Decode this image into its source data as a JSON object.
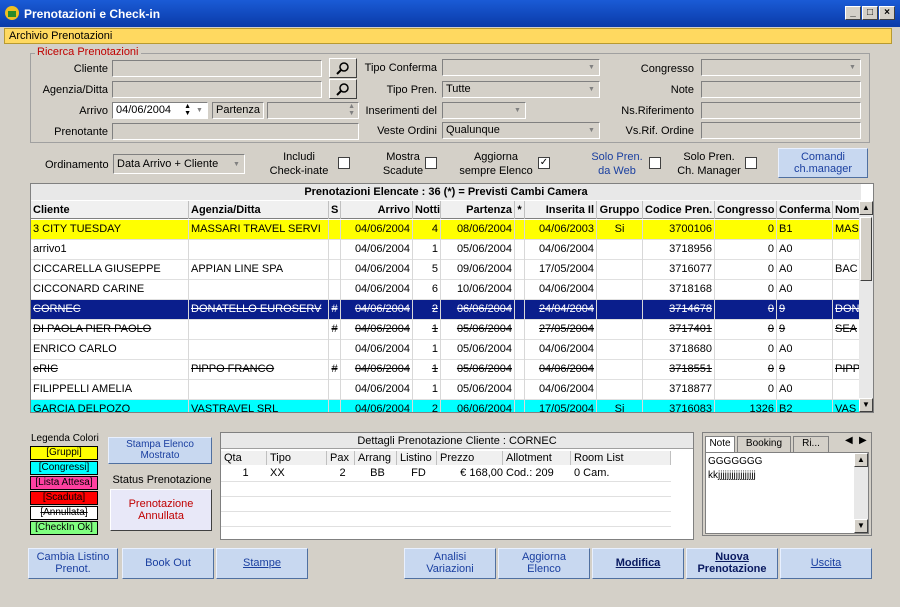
{
  "window": {
    "title": "Prenotazioni e Check-in",
    "min": "_",
    "max": "□",
    "close": "×"
  },
  "archive_bar": "Archivio Prenotazioni",
  "search": {
    "group_title": "Ricerca Prenotazioni",
    "cliente_label": "Cliente",
    "cliente_value": "",
    "agenzia_label": "Agenzia/Ditta",
    "agenzia_value": "",
    "arrivo_label": "Arrivo",
    "arrivo_value": "04/06/2004",
    "partenza_label": "Partenza",
    "partenza_value": "",
    "prenotante_label": "Prenotante",
    "prenotante_value": "",
    "tipo_conferma_label": "Tipo Conferma",
    "tipo_conferma_value": "",
    "tipo_pren_label": "Tipo Pren.",
    "tipo_pren_value": "Tutte",
    "inserimenti_label": "Inserimenti del",
    "inserimenti_value": "",
    "veste_label": "Veste Ordini",
    "veste_value": "Qualunque",
    "congresso_label": "Congresso",
    "congresso_value": "",
    "note_label": "Note",
    "note_value": "",
    "nsrif_label": "Ns.Riferimento",
    "nsrif_value": "",
    "vsrif_label": "Vs.Rif. Ordine",
    "vsrif_value": ""
  },
  "options": {
    "ordinamento_label": "Ordinamento",
    "ordinamento_value": "Data Arrivo + Cliente",
    "includi_label1": "Includi",
    "includi_label2": "Check-inate",
    "includi_checked": false,
    "mostra_label1": "Mostra",
    "mostra_label2": "Scadute",
    "mostra_checked": false,
    "aggiorna_label1": "Aggiorna",
    "aggiorna_label2": "sempre Elenco",
    "aggiorna_checked": true,
    "solo_web_label1": "Solo Pren.",
    "solo_web_label2": "da Web",
    "solo_web_checked": false,
    "solo_ch_label1": "Solo Pren.",
    "solo_ch_label2": "Ch. Manager",
    "solo_ch_checked": false,
    "comandi_label1": "Comandi",
    "comandi_label2": "ch.manager"
  },
  "grid": {
    "header": "Prenotazioni Elencate : 36   (*) = Previsti Cambi Camera",
    "columns": [
      "Cliente",
      "Agenzia/Ditta",
      "S",
      "Arrivo",
      "Notti",
      "Partenza",
      "*",
      "Inserita Il",
      "Gruppo",
      "Codice Pren.",
      "Congresso",
      "Conferma",
      "Nom"
    ],
    "rows": [
      {
        "cliente": "3 CITY TUESDAY",
        "agenzia": "MASSARI TRAVEL SERVI",
        "s": "",
        "arrivo": "04/06/2004",
        "notti": "4",
        "partenza": "08/06/2004",
        "star": "",
        "inserita": "04/06/2003",
        "gruppo": "Si",
        "codice": "3700106",
        "congresso": "0",
        "conferma": "B1",
        "nom": "MAS",
        "style": "yellow"
      },
      {
        "cliente": "arrivo1",
        "agenzia": "",
        "s": "",
        "arrivo": "04/06/2004",
        "notti": "1",
        "partenza": "05/06/2004",
        "star": "",
        "inserita": "04/06/2004",
        "gruppo": "",
        "codice": "3718956",
        "congresso": "0",
        "conferma": "A0",
        "nom": "",
        "style": "white"
      },
      {
        "cliente": "CICCARELLA GIUSEPPE",
        "agenzia": "APPIAN LINE SPA",
        "s": "",
        "arrivo": "04/06/2004",
        "notti": "5",
        "partenza": "09/06/2004",
        "star": "",
        "inserita": "17/05/2004",
        "gruppo": "",
        "codice": "3716077",
        "congresso": "0",
        "conferma": "A0",
        "nom": "BAC",
        "style": "white"
      },
      {
        "cliente": "CICCONARD CARINE",
        "agenzia": "",
        "s": "",
        "arrivo": "04/06/2004",
        "notti": "6",
        "partenza": "10/06/2004",
        "star": "",
        "inserita": "04/06/2004",
        "gruppo": "",
        "codice": "3718168",
        "congresso": "0",
        "conferma": "A0",
        "nom": "",
        "style": "white"
      },
      {
        "cliente": "CORNEC",
        "agenzia": "DONATELLO EUROSERV",
        "s": "#",
        "arrivo": "04/06/2004",
        "notti": "2",
        "partenza": "06/06/2004",
        "star": "",
        "inserita": "24/04/2004",
        "gruppo": "",
        "codice": "3714678",
        "congresso": "0",
        "conferma": "9",
        "nom": "DON",
        "style": "selected"
      },
      {
        "cliente": "DI PAOLA PIER PAOLO",
        "agenzia": "",
        "s": "#",
        "arrivo": "04/06/2004",
        "notti": "1",
        "partenza": "05/06/2004",
        "star": "",
        "inserita": "27/05/2004",
        "gruppo": "",
        "codice": "3717401",
        "congresso": "0",
        "conferma": "9",
        "nom": "SEA",
        "style": "strike"
      },
      {
        "cliente": "ENRICO CARLO",
        "agenzia": "",
        "s": "",
        "arrivo": "04/06/2004",
        "notti": "1",
        "partenza": "05/06/2004",
        "star": "",
        "inserita": "04/06/2004",
        "gruppo": "",
        "codice": "3718680",
        "congresso": "0",
        "conferma": "A0",
        "nom": "",
        "style": "white"
      },
      {
        "cliente": "eRIC",
        "agenzia": "PIPPO FRANCO",
        "s": "#",
        "arrivo": "04/06/2004",
        "notti": "1",
        "partenza": "05/06/2004",
        "star": "",
        "inserita": "04/06/2004",
        "gruppo": "",
        "codice": "3718551",
        "congresso": "0",
        "conferma": "9",
        "nom": "PIPP",
        "style": "strike"
      },
      {
        "cliente": "FILIPPELLI AMELIA",
        "agenzia": "",
        "s": "",
        "arrivo": "04/06/2004",
        "notti": "1",
        "partenza": "05/06/2004",
        "star": "",
        "inserita": "04/06/2004",
        "gruppo": "",
        "codice": "3718877",
        "congresso": "0",
        "conferma": "A0",
        "nom": "",
        "style": "white"
      },
      {
        "cliente": "GARCIA DELPOZO",
        "agenzia": "VASTRAVEL SRL",
        "s": "",
        "arrivo": "04/06/2004",
        "notti": "2",
        "partenza": "06/06/2004",
        "star": "",
        "inserita": "17/05/2004",
        "gruppo": "Si",
        "codice": "3716083",
        "congresso": "1326",
        "conferma": "B2",
        "nom": "VAS",
        "style": "cyan"
      }
    ]
  },
  "legend": {
    "title": "Legenda Colori",
    "items": [
      {
        "label": "[Gruppi]",
        "bg": "#ffff00",
        "strike": false
      },
      {
        "label": "[Congressi]",
        "bg": "#00ffff",
        "strike": false
      },
      {
        "label": "[Lista Attesa]",
        "bg": "#ff40a0",
        "strike": false
      },
      {
        "label": "[Scaduta]",
        "bg": "#ff0000",
        "strike": false
      },
      {
        "label": "[Annullata]",
        "bg": "#ffffff",
        "strike": true
      },
      {
        "label": "[CheckIn Ok]",
        "bg": "#80ff80",
        "strike": false
      }
    ]
  },
  "status": {
    "stampa_label1": "Stampa Elenco",
    "stampa_label2": "Mostrato",
    "status_title": "Status Prenotazione",
    "status_value1": "Prenotazione",
    "status_value2": "Annullata"
  },
  "details": {
    "title": "Dettagli Prenotazione Cliente : CORNEC",
    "columns": [
      "Qta",
      "Tipo",
      "Pax",
      "Arrang",
      "Listino",
      "Prezzo",
      "Allotment",
      "Room List"
    ],
    "rows": [
      {
        "qta": "1",
        "tipo": "XX",
        "pax": "2",
        "arrang": "BB",
        "listino": "FD",
        "prezzo": "€ 168,00",
        "allotment": "Cod.: 209",
        "roomlist": "0 Cam."
      }
    ]
  },
  "notes_panel": {
    "tabs": [
      "Note",
      "Booking",
      "Ri..."
    ],
    "line1": "GGGGGGG",
    "line2": "kkjjjjjjjjjjjjjjjjj"
  },
  "bottom_buttons": {
    "cambia1": "Cambia Listino",
    "cambia2": "Prenot.",
    "bookout": "Book Out",
    "stampe": "Stampe",
    "analisi1": "Analisi",
    "analisi2": "Variazioni",
    "aggiorna1": "Aggiorna",
    "aggiorna2": "Elenco",
    "modifica": "Modifica",
    "nuova1": "Nuova",
    "nuova2": "Prenotazione",
    "uscita": "Uscita"
  },
  "colors": {
    "accent": "#0a246a",
    "yellow": "#ffff00",
    "cyan": "#00ffff",
    "selected": "#0a1e8c"
  }
}
